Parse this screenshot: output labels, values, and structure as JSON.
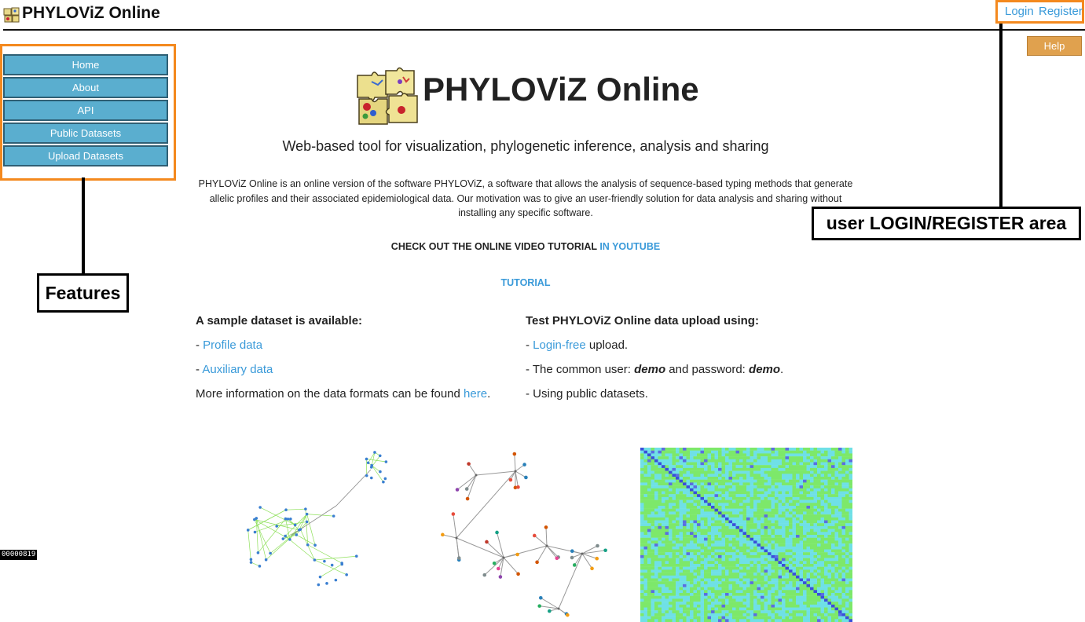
{
  "header": {
    "title": "PHYLOViZ Online",
    "login": "Login",
    "register": "Register",
    "help": "Help"
  },
  "sidebar": {
    "items": [
      {
        "label": "Home"
      },
      {
        "label": "About"
      },
      {
        "label": "API"
      },
      {
        "label": "Public Datasets"
      },
      {
        "label": "Upload Datasets"
      }
    ]
  },
  "annotations": {
    "features": "Features",
    "user_area": "user LOGIN/REGISTER area",
    "id_tag": "00000819"
  },
  "main": {
    "title": "PHYLOViZ Online",
    "tagline": "Web-based tool for visualization, phylogenetic inference, analysis and sharing",
    "description": "PHYLOViZ Online is an online version of the software PHYLOViZ, a software that allows the analysis of sequence-based typing methods that generate allelic profiles and their associated epidemiological data. Our motivation was to give an user-friendly solution for data analysis and sharing without installing any specific software.",
    "video_text": "CHECK OUT THE ONLINE VIDEO TUTORIAL ",
    "video_link": "IN YOUTUBE",
    "tutorial_link": "TUTORIAL",
    "left_col": {
      "heading": "A sample dataset is available:",
      "dash1": "- ",
      "profile_link": "Profile data",
      "dash2": "- ",
      "aux_link": "Auxiliary data",
      "more_text": "More information on the data formats can be found ",
      "here_link": "here",
      "period": "."
    },
    "right_col": {
      "heading": "Test PHYLOViZ Online data upload using:",
      "dash1": "- ",
      "login_free_link": "Login-free",
      "upload_text": " upload.",
      "common_user_text": "- The common user: ",
      "demo_user": "demo",
      "password_text": " and password: ",
      "demo_pass": "demo",
      "period": ".",
      "public_text": "- Using public datasets."
    }
  },
  "colors": {
    "accent_orange": "#f4891e",
    "link_blue": "#3a9ad9",
    "nav_button": "#5aaecf",
    "help_button": "#e0a14e",
    "matrix_green": "#7de86a",
    "matrix_cyan": "#6fe0e6",
    "matrix_diag": "#3a4fd9"
  },
  "icons": {
    "header_logo": "puzzle-pieces-icon",
    "main_logo": "puzzle-pieces-logo"
  }
}
